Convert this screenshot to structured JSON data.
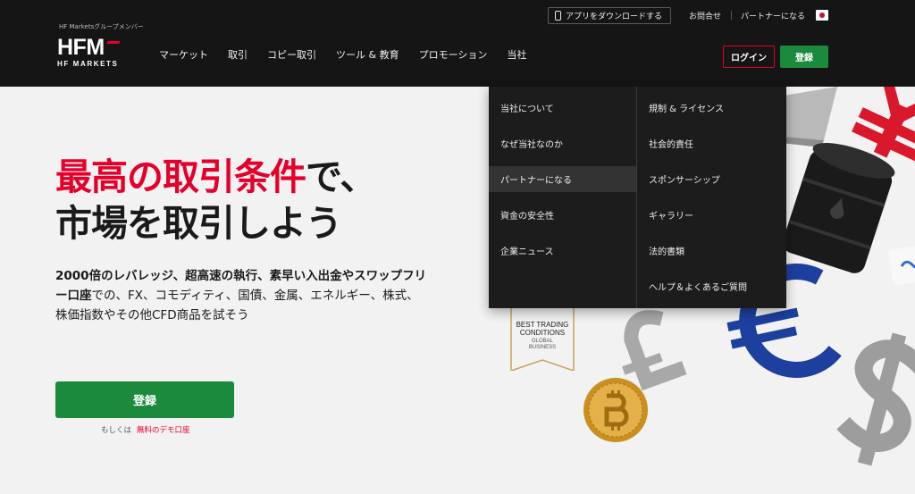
{
  "header": {
    "tagline": "HF Marketsグループメンバー",
    "logo_text": "HFM",
    "logo_sub": "HF MARKETS",
    "app_download": "アプリをダウンロードする",
    "contact": "お問合せ",
    "become_partner": "パートナーになる",
    "login": "ログイン",
    "register": "登録",
    "nav": [
      "マーケット",
      "取引",
      "コピー取引",
      "ツール & 教育",
      "プロモーション",
      "当社"
    ]
  },
  "dropdown": {
    "left": [
      "当社について",
      "なぜ当社なのか",
      "パートナーになる",
      "資金の安全性",
      "企業ニュース"
    ],
    "right": [
      "規制 & ライセンス",
      "社会的責任",
      "スポンサーシップ",
      "ギャラリー",
      "法的書類",
      "ヘルプ＆よくあるご質問"
    ],
    "active_index": 2
  },
  "hero": {
    "title_red": "最高の取引条件",
    "title_rest_line1": "で、",
    "title_line2": "市場を取引しよう",
    "desc_bold": "2000倍のレバレッジ、超高速の執行、素早い入出金やスワップフリー口座",
    "desc_rest": "での、FX、コモディティ、国債、金属、エネルギー、株式、株価指数やその他CFD商品を試そう",
    "cta": "登録",
    "demo_prefix": "もしくは",
    "demo_link": "無料のデモ口座"
  },
  "award": {
    "line1": "BEST TRADING",
    "line2": "CONDITIONS",
    "line3": "GLOBAL",
    "line4": "BUSINESS"
  },
  "colors": {
    "header_bg": "#151515",
    "brand_red": "#e4002b",
    "brand_green": "#1c8a3c",
    "dropdown_bg": "#1c1c1c",
    "page_bg": "#f2f2f2"
  }
}
